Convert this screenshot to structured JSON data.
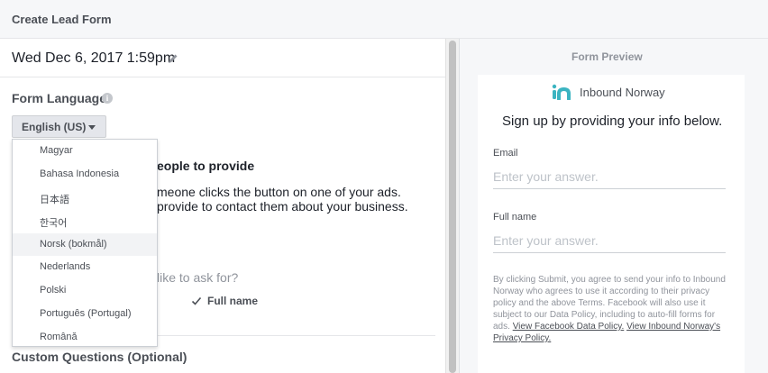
{
  "header": {
    "title": "Create Lead Form"
  },
  "form": {
    "name": "Wed Dec 6, 2017 1:59pm",
    "language_label": "Form Language",
    "language_selected": "English (US)",
    "language_options": [
      "Magyar",
      "Bahasa Indonesia",
      "日本語",
      "한국어",
      "Norsk (bokmål)",
      "Nederlands",
      "Polski",
      "Português (Portugal)",
      "Română"
    ],
    "hovered_option": "Norsk (bokmål)"
  },
  "background": {
    "heading_fragment": "eople to provide",
    "desc_line1": "meone clicks the button on one of your ads.",
    "desc_line2": "provide to contact them about your business.",
    "ask_fragment": "like to ask for?",
    "checked_field": "Full name"
  },
  "custom_questions": {
    "label": "Custom Questions (Optional)"
  },
  "preview": {
    "title": "Form Preview",
    "brand_name": "Inbound Norway",
    "signup_text": "Sign up by providing your info below.",
    "email_label": "Email",
    "email_placeholder": "Enter your answer.",
    "fullname_label": "Full name",
    "fullname_placeholder": "Enter your answer.",
    "legal_text": "By clicking Submit, you agree to send your info to Inbound Norway who agrees to use it according to their privacy policy and the above Terms. Facebook will also use it subject to our Data Policy, including to auto-fill forms for ads.",
    "legal_link1": "View Facebook Data Policy.",
    "legal_link2": "View Inbound Norway's Privacy Policy."
  },
  "colors": {
    "brand_teal": "#3bb4c1",
    "border": "#ccd0d5"
  },
  "icons": {
    "edit": "pencil-icon",
    "info": "info-icon",
    "dropdown": "caret-down-icon",
    "check": "checkmark-icon",
    "logo": "inbound-norway-logo-icon"
  }
}
